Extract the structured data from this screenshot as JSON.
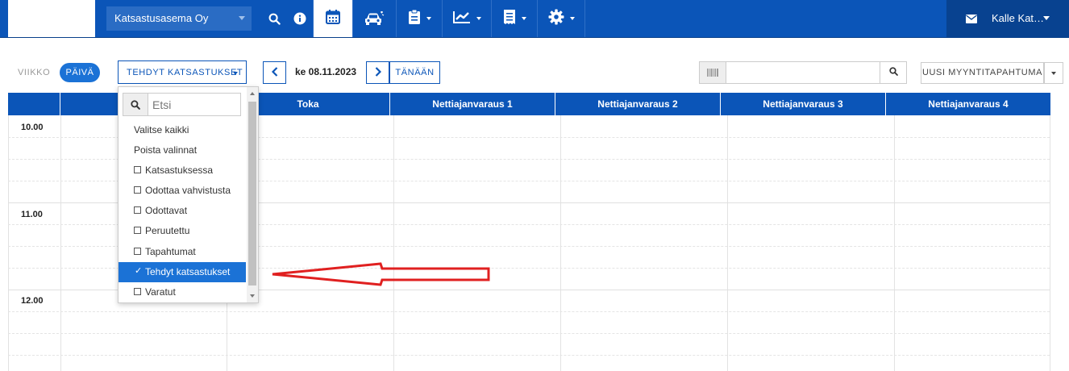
{
  "topbar": {
    "station": "Katsastusasema Oy",
    "user": "Kalle Kat…",
    "icons": [
      "search-icon",
      "info-icon",
      "calendar-icon",
      "car-icon",
      "clipboard-icon",
      "chart-icon",
      "receipt-icon",
      "gear-icon",
      "envelope-icon"
    ]
  },
  "toolbar": {
    "week": "VIIKKO",
    "day": "PÄIVÄ",
    "filter": "TEHDYT KATSASTUKSET",
    "date": "ke 08.11.2023",
    "today": "TÄNÄÄN",
    "search_placeholder": "",
    "new_sale": "UUSI MYYNTITAPAHTUMA"
  },
  "calendar": {
    "columns": [
      "",
      "",
      "Toka",
      "Nettiajanvaraus 1",
      "Nettiajanvaraus 2",
      "Nettiajanvaraus 3",
      "Nettiajanvaraus 4"
    ],
    "times": [
      "10.00",
      "11.00",
      "12.00"
    ]
  },
  "dropdown": {
    "search_placeholder": "Etsi",
    "select_all": "Valitse kaikki",
    "clear_all": "Poista valinnat",
    "options": [
      {
        "label": "Katsastuksessa",
        "checked": false
      },
      {
        "label": "Odottaa vahvistusta",
        "checked": false
      },
      {
        "label": "Odottavat",
        "checked": false
      },
      {
        "label": "Peruutettu",
        "checked": false
      },
      {
        "label": "Tapahtumat",
        "checked": false
      },
      {
        "label": "Tehdyt katsastukset",
        "checked": true
      },
      {
        "label": "Varatut",
        "checked": false
      }
    ]
  },
  "annotation": {
    "arrow_color": "#e02020"
  },
  "colors": {
    "brand": "#0b55b8",
    "accent": "#1b72d6"
  }
}
